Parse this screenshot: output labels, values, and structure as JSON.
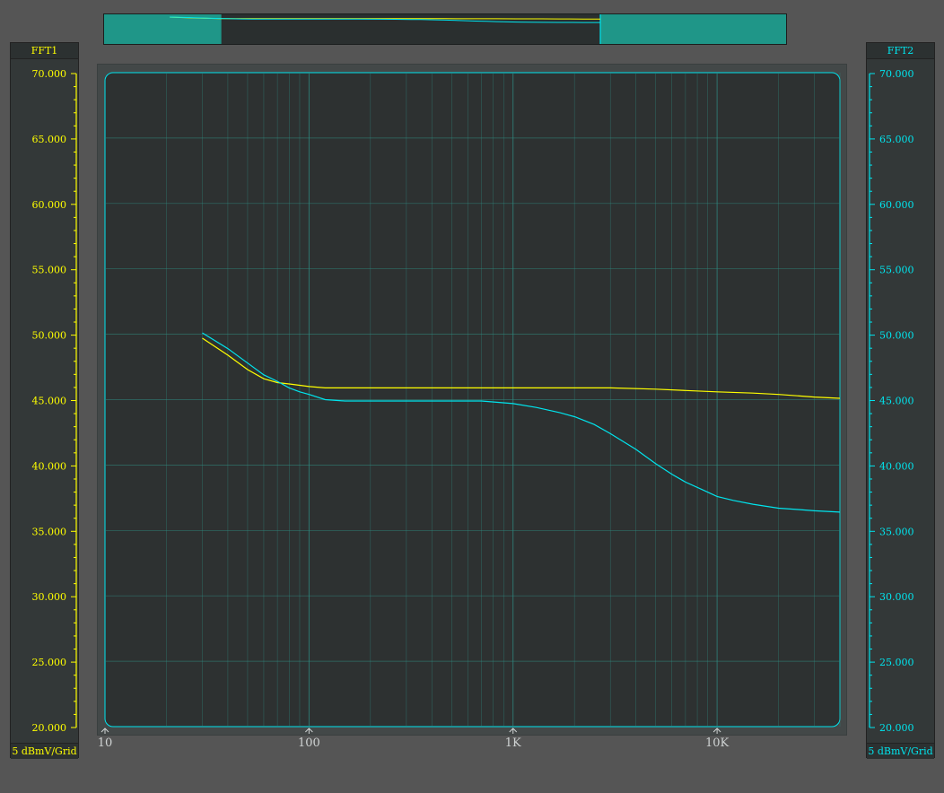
{
  "left_axis": {
    "title": "FFT1",
    "unit_label": "5 dBmV/Grid",
    "color": "#ffff00"
  },
  "right_axis": {
    "title": "FFT2",
    "unit_label": "5 dBmV/Grid",
    "color": "#00e5ee"
  },
  "colors": {
    "grid": "#2f8a80",
    "plot_bg": "#2d3131",
    "overview_band": "#1f9688"
  },
  "chart_data": {
    "type": "line",
    "x_scale": "log",
    "xlim": [
      10,
      40000
    ],
    "ylim": [
      20,
      70
    ],
    "y_ticks": [
      "70.000",
      "65.000",
      "60.000",
      "55.000",
      "50.000",
      "45.000",
      "40.000",
      "35.000",
      "30.000",
      "25.000",
      "20.000"
    ],
    "x_ticks": [
      {
        "value": 10,
        "label": "10"
      },
      {
        "value": 100,
        "label": "100"
      },
      {
        "value": 1000,
        "label": "1K"
      },
      {
        "value": 10000,
        "label": "10K"
      }
    ],
    "grid": true,
    "series": [
      {
        "name": "FFT1",
        "color": "#ffff00",
        "points": [
          [
            30,
            49.7
          ],
          [
            40,
            48.4
          ],
          [
            50,
            47.3
          ],
          [
            60,
            46.6
          ],
          [
            70,
            46.3
          ],
          [
            80,
            46.2
          ],
          [
            90,
            46.1
          ],
          [
            100,
            46.0
          ],
          [
            120,
            45.9
          ],
          [
            150,
            45.9
          ],
          [
            200,
            45.9
          ],
          [
            300,
            45.9
          ],
          [
            500,
            45.9
          ],
          [
            1000,
            45.9
          ],
          [
            2000,
            45.9
          ],
          [
            3000,
            45.9
          ],
          [
            5000,
            45.8
          ],
          [
            7000,
            45.7
          ],
          [
            10000,
            45.6
          ],
          [
            15000,
            45.5
          ],
          [
            20000,
            45.4
          ],
          [
            30000,
            45.2
          ],
          [
            40000,
            45.1
          ]
        ]
      },
      {
        "name": "FFT2",
        "color": "#00e5ee",
        "points": [
          [
            30,
            50.1
          ],
          [
            40,
            48.9
          ],
          [
            50,
            47.8
          ],
          [
            60,
            46.9
          ],
          [
            70,
            46.4
          ],
          [
            80,
            45.9
          ],
          [
            90,
            45.6
          ],
          [
            100,
            45.4
          ],
          [
            120,
            45.0
          ],
          [
            150,
            44.9
          ],
          [
            200,
            44.9
          ],
          [
            300,
            44.9
          ],
          [
            500,
            44.9
          ],
          [
            700,
            44.9
          ],
          [
            1000,
            44.7
          ],
          [
            1300,
            44.4
          ],
          [
            1700,
            44.0
          ],
          [
            2000,
            43.7
          ],
          [
            2500,
            43.1
          ],
          [
            3000,
            42.4
          ],
          [
            4000,
            41.2
          ],
          [
            5000,
            40.1
          ],
          [
            6000,
            39.3
          ],
          [
            7000,
            38.7
          ],
          [
            8500,
            38.1
          ],
          [
            10000,
            37.6
          ],
          [
            12000,
            37.3
          ],
          [
            15000,
            37.0
          ],
          [
            20000,
            36.7
          ],
          [
            25000,
            36.6
          ],
          [
            30000,
            36.5
          ],
          [
            40000,
            36.4
          ]
        ]
      }
    ]
  }
}
